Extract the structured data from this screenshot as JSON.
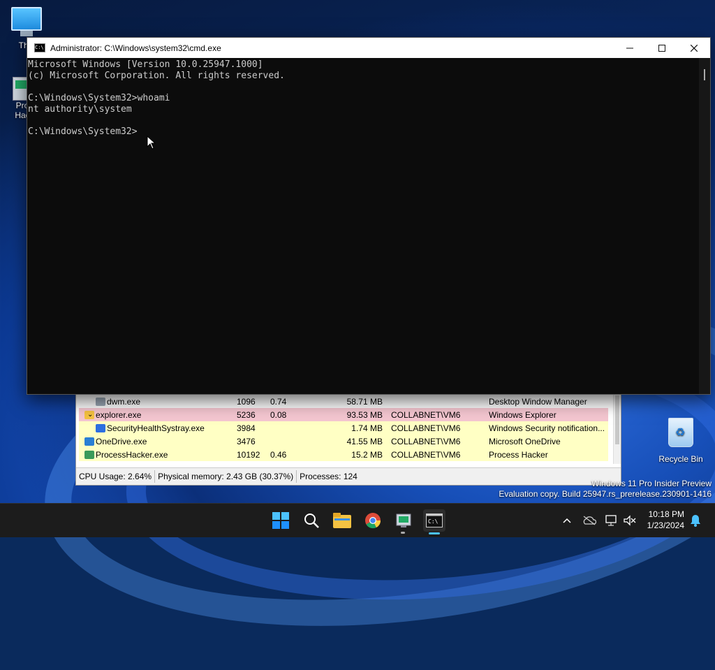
{
  "desktop": {
    "this_pc_label": "This",
    "process_hacker_label_1": "Pro",
    "process_hacker_label_2": "Hac",
    "recycle_bin_label": "Recycle Bin",
    "watermark_line1": "Windows 11 Pro Insider Preview",
    "watermark_line2": "Evaluation copy. Build 25947.rs_prerelease.230901-1416"
  },
  "cmd": {
    "title": "Administrator: C:\\Windows\\system32\\cmd.exe",
    "lines": [
      "Microsoft Windows [Version 10.0.25947.1000]",
      "(c) Microsoft Corporation. All rights reserved.",
      "",
      "C:\\Windows\\System32>whoami",
      "nt authority\\system",
      "",
      "C:\\Windows\\System32>"
    ]
  },
  "process_hacker": {
    "rows": [
      {
        "name": "dwm.exe",
        "pid": "1096",
        "cpu": "0.74",
        "mem": "58.71 MB",
        "user": "",
        "desc": "Desktop Window Manager",
        "color": "#ffffff"
      },
      {
        "name": "explorer.exe",
        "pid": "5236",
        "cpu": "0.08",
        "mem": "93.53 MB",
        "user": "COLLABNET\\VM6",
        "desc": "Windows Explorer",
        "color": "#f4c6d0"
      },
      {
        "name": "SecurityHealthSystray.exe",
        "pid": "3984",
        "cpu": "",
        "mem": "1.74 MB",
        "user": "COLLABNET\\VM6",
        "desc": "Windows Security notification...",
        "color": "#ffffc4"
      },
      {
        "name": "OneDrive.exe",
        "pid": "3476",
        "cpu": "",
        "mem": "41.55 MB",
        "user": "COLLABNET\\VM6",
        "desc": "Microsoft OneDrive",
        "color": "#ffffc4"
      },
      {
        "name": "ProcessHacker.exe",
        "pid": "10192",
        "cpu": "0.46",
        "mem": "15.2 MB",
        "user": "COLLABNET\\VM6",
        "desc": "Process Hacker",
        "color": "#ffffc4"
      }
    ],
    "status": {
      "cpu": "CPU Usage: 2.64%",
      "memory": "Physical memory: 2.43 GB (30.37%)",
      "processes": "Processes: 124"
    }
  },
  "taskbar": {
    "time": "10:18 PM",
    "date": "1/23/2024",
    "icons": [
      "windows-start-icon",
      "search-icon",
      "file-explorer-icon",
      "chrome-icon",
      "process-hacker-icon",
      "cmd-icon"
    ]
  }
}
